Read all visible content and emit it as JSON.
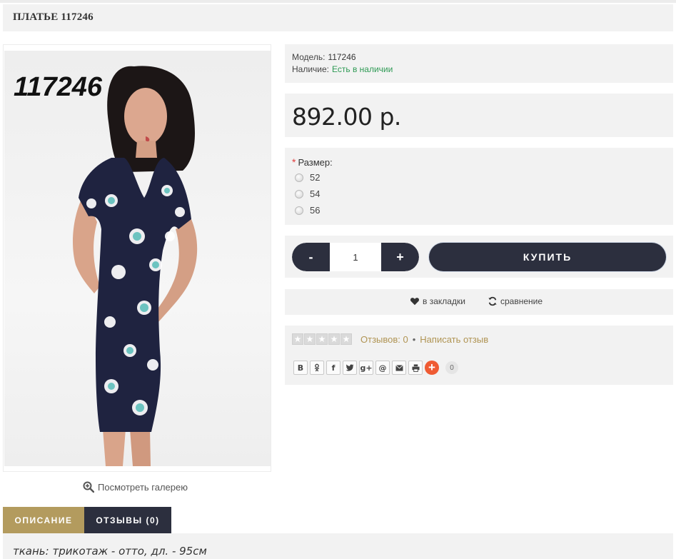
{
  "product": {
    "title": "ПЛАТЬЕ 117246",
    "photo_code": "117246",
    "gallery_link": "Посмотреть галерею"
  },
  "info": {
    "model_label": "Модель:",
    "model_value": "117246",
    "stock_label": "Наличие:",
    "stock_value": "Есть в наличии"
  },
  "price": "892.00 р.",
  "options": {
    "required_mark": "*",
    "label": "Размер:",
    "sizes": [
      "52",
      "54",
      "56"
    ]
  },
  "cart": {
    "minus": "-",
    "quantity": "1",
    "plus": "+",
    "buy_label": "КУПИТЬ"
  },
  "actions": {
    "wishlist": "в закладки",
    "compare": "сравнение"
  },
  "reviews": {
    "rating_stars": 0,
    "rating_max": 5,
    "count_text": "Отзывов: 0",
    "separator": "•",
    "write": "Написать отзыв"
  },
  "share": {
    "buttons": [
      "В",
      "ок-icon",
      "f",
      "twitter-icon",
      "g+",
      "@",
      "mail-icon",
      "print-icon"
    ],
    "count": "0"
  },
  "tabs": [
    {
      "label": "ОПИСАНИЕ",
      "active": true
    },
    {
      "label": "ОТЗЫВЫ (0)",
      "active": false
    }
  ],
  "description": "ткань: трикотаж - отто,  дл. - 95см",
  "colors": {
    "dark": "#2c2f3e",
    "gold": "#b39b5e",
    "instock": "#2e9a54",
    "panel": "#f2f2f2",
    "share_plus": "#ef5b33"
  }
}
